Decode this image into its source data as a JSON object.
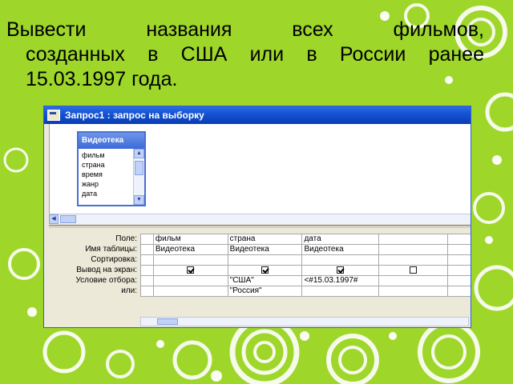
{
  "title": {
    "line1_words": [
      "Вывести",
      "названия",
      "всех",
      "фильмов,"
    ],
    "line2_words": [
      "созданных",
      "в",
      "США",
      "или",
      "в",
      "России",
      "ранее"
    ],
    "line3": "15.03.1997 года."
  },
  "window": {
    "title": "Запрос1 : запрос на выборку"
  },
  "table_box": {
    "title": "Видеотека",
    "fields": [
      "фильм",
      "страна",
      "время",
      "жанр",
      "дата"
    ]
  },
  "grid": {
    "row_labels": [
      "Поле:",
      "Имя таблицы:",
      "Сортировка:",
      "Вывод на экран:",
      "Условие отбора:",
      "или:"
    ],
    "columns": [
      {
        "field": "фильм",
        "table": "Видеотека",
        "sort": "",
        "show": true,
        "criteria": "",
        "or": ""
      },
      {
        "field": "страна",
        "table": "Видеотека",
        "sort": "",
        "show": true,
        "criteria": "\"США\"",
        "or": "\"Россия\""
      },
      {
        "field": "дата",
        "table": "Видеотека",
        "sort": "",
        "show": true,
        "criteria": "<#15.03.1997#",
        "or": ""
      },
      {
        "field": "",
        "table": "",
        "sort": "",
        "show": false,
        "criteria": "",
        "or": ""
      }
    ]
  },
  "colors": {
    "background": "#9ed62a",
    "titlebar": "#1454d4",
    "window_bg": "#ece9d8"
  },
  "icons": [
    "app-icon",
    "scroll-up-icon",
    "scroll-down-icon",
    "scroll-left-icon",
    "checkbox-icon"
  ]
}
